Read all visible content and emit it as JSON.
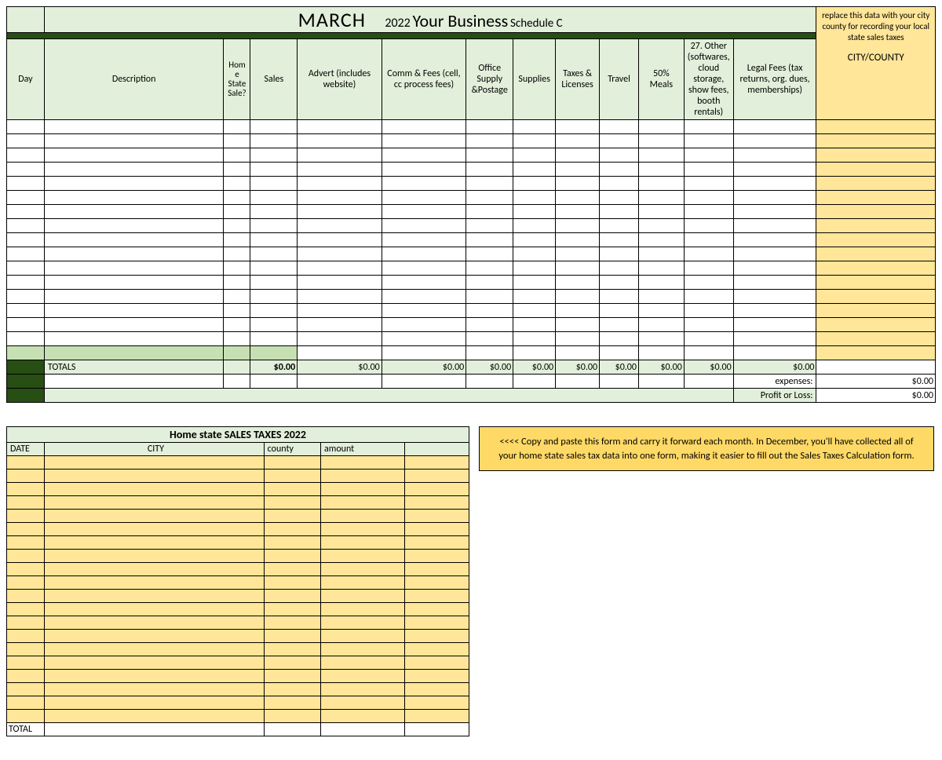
{
  "header": {
    "month": "MARCH",
    "year": "2022",
    "business": "Your Business",
    "schedule": "Schedule C"
  },
  "columns": {
    "day": "Day",
    "description": "Description",
    "home_state_sale": "Home State Sale?",
    "sales": "Sales",
    "advert": "Advert (includes website)",
    "comm_fees": "Comm & Fees (cell, cc process fees)",
    "office": "Office Supply &Postage",
    "supplies": "Supplies",
    "taxes_licenses": "Taxes & Licenses",
    "travel": "Travel",
    "meals": "50% Meals",
    "other": "27. Other (softwares, cloud storage, show fees, booth rentals)",
    "legal": "Legal Fees (tax returns, org. dues, memberships)"
  },
  "side_note": {
    "instruction": "replace this data with your city county for recording your local state sales taxes",
    "label": "CITY/COUNTY"
  },
  "totals": {
    "label": "TOTALS",
    "sales": "$0.00",
    "advert": "$0.00",
    "comm_fees": "$0.00",
    "office": "$0.00",
    "supplies": "$0.00",
    "taxes_licenses": "$0.00",
    "travel": "$0.00",
    "meals": "$0.00",
    "other": "$0.00",
    "legal": "$0.00",
    "expenses_label": "expenses:",
    "expenses_value": "$0.00",
    "pl_label": "Profit or Loss:",
    "pl_value": "$0.00"
  },
  "sales_tax": {
    "title": "Home state SALES TAXES 2022",
    "cols": {
      "date": "DATE",
      "city": "CITY",
      "county": "county",
      "amount": "amount"
    },
    "total_label": "TOTAL"
  },
  "tip": "<<<<    Copy and paste this form and carry it forward each month. In December, you'll have collected all of your home state sales tax data into one form, making it easier to fill out the Sales Taxes Calculation form."
}
